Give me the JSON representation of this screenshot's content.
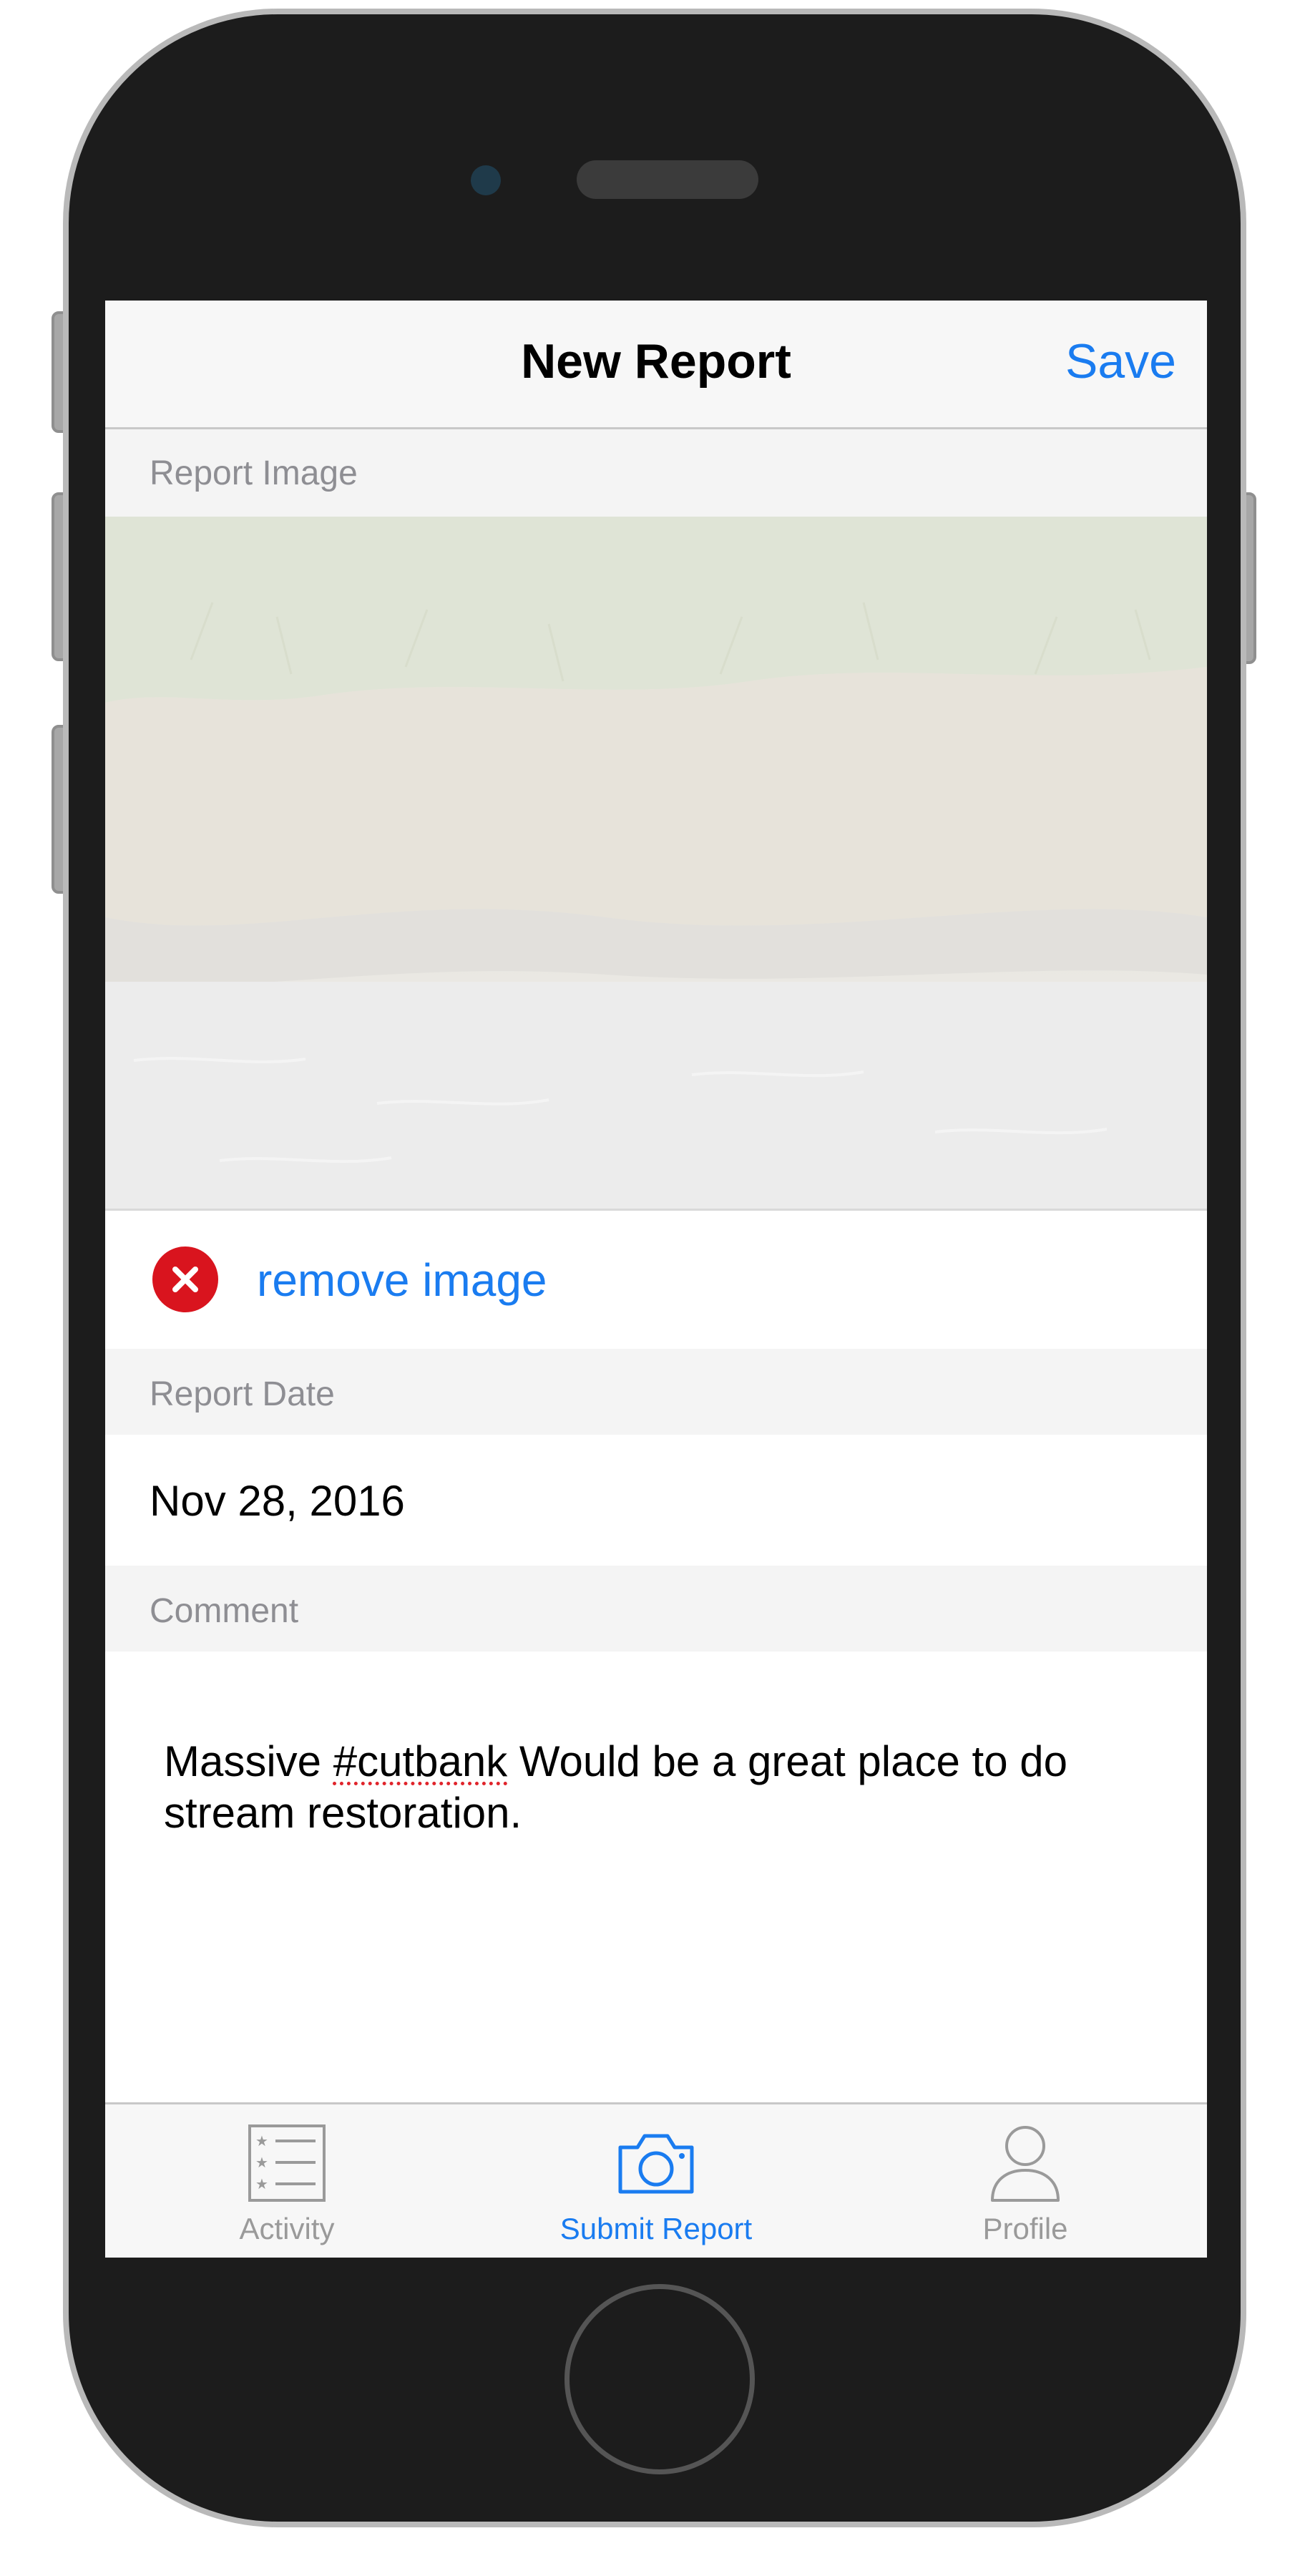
{
  "navigation": {
    "title": "New Report",
    "save_label": "Save"
  },
  "sections": {
    "image_header": "Report Image",
    "date_header": "Report Date",
    "comment_header": "Comment"
  },
  "image": {
    "remove_label": "remove image"
  },
  "report_date": "Nov 28, 2016",
  "comment": {
    "before_hashtag": "Massive ",
    "hashtag": "#cutbank",
    "after_hashtag": " Would be a great place to do stream restoration."
  },
  "tab_bar": {
    "items": [
      {
        "label": "Activity",
        "icon": "list-icon",
        "selected": false
      },
      {
        "label": "Submit Report",
        "icon": "camera-icon",
        "selected": true
      },
      {
        "label": "Profile",
        "icon": "person-icon",
        "selected": false
      }
    ]
  },
  "colors": {
    "accent": "#1a7cf0",
    "destructive": "#d9141e",
    "section_header_text": "#8e8e93",
    "phone_body": "#1c1c1c"
  }
}
